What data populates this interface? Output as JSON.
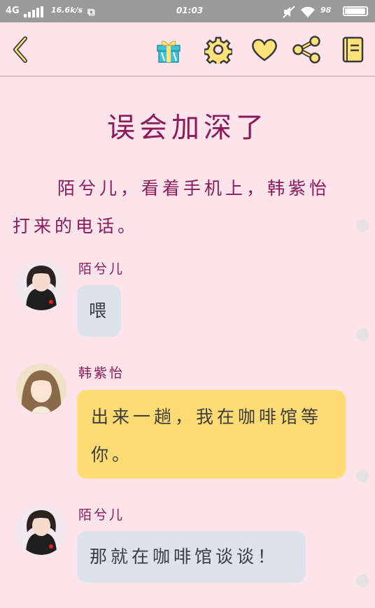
{
  "status_bar": {
    "network": "4G",
    "speed": "16.6k/s",
    "time": "01:03",
    "battery": "98",
    "battery_level_percent": 98
  },
  "toolbar": {
    "icons": [
      "back-icon",
      "gift-icon",
      "gear-icon",
      "heart-icon",
      "share-icon",
      "book-icon"
    ]
  },
  "story": {
    "title": "误会加深了",
    "narration": "陌兮儿，看着手机上，韩紫怡打来的电话。"
  },
  "messages": [
    {
      "speaker": "陌兮儿",
      "text": "喂",
      "bubble_color": "#dde3ea"
    },
    {
      "speaker": "韩紫怡",
      "text": "出来一趟，我在咖啡馆等你。",
      "bubble_color": "#ffdc73"
    },
    {
      "speaker": "陌兮儿",
      "text": "那就在咖啡馆谈谈！",
      "bubble_color": "#dde3ea"
    }
  ],
  "colors": {
    "background": "#fce4ea",
    "accent": "#8b1a5a",
    "icon_yellow": "#ffe27a"
  }
}
